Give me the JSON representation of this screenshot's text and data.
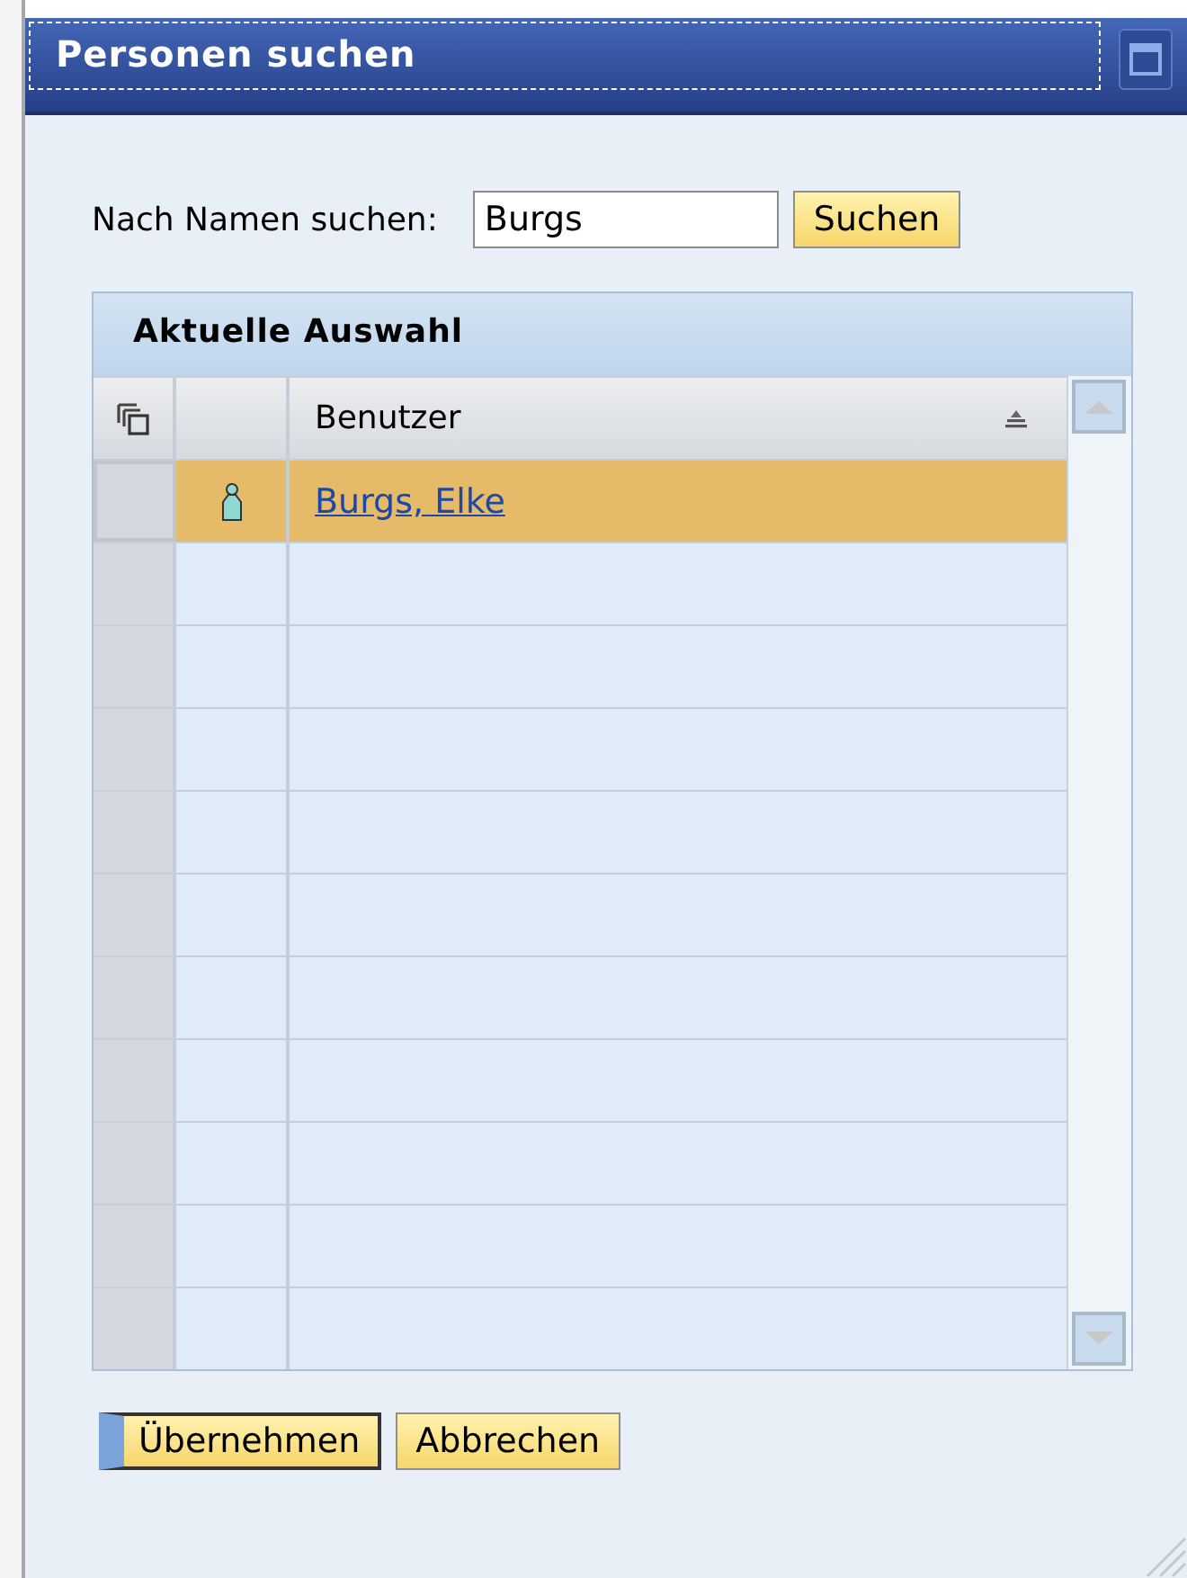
{
  "window": {
    "title": "Personen suchen"
  },
  "search": {
    "label": "Nach Namen suchen:",
    "value": "Burgs",
    "button": "Suchen"
  },
  "table": {
    "title": "Aktuelle Auswahl",
    "columns": [
      {
        "label": "Benutzer",
        "sorted": true
      }
    ],
    "rows": [
      {
        "user": "Burgs, Elke",
        "selected": true
      }
    ]
  },
  "buttons": [
    {
      "label": "Übernehmen",
      "default": true
    },
    {
      "label": "Abbrechen",
      "default": false
    }
  ]
}
